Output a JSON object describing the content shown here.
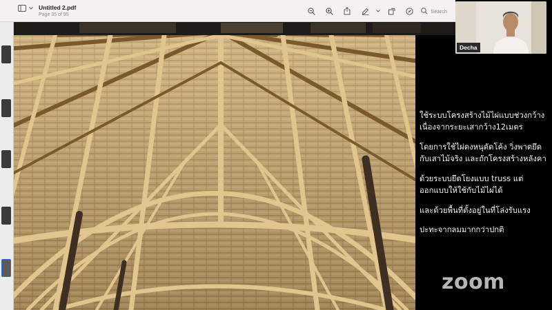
{
  "viewer": {
    "title": "Untitled 2.pdf",
    "subtitle": "Page 35 of 95",
    "search_placeholder": "Search",
    "icons": [
      "sidebar-toggle-icon",
      "chevron-down-icon",
      "zoom-out-icon",
      "zoom-in-icon",
      "share-icon",
      "markup-pen-icon",
      "chevron-down-icon",
      "rotate-icon",
      "annotate-icon",
      "search-icon"
    ]
  },
  "slide": {
    "photo_subject": "",
    "text": [
      "ใช้ระบบโครงสร้างไม้ไผ่แบบช่วงกว้าง เนื่องจากระยะเสากว้าง12เมตร",
      "โดยการใช้ไผ่ดงหนุดัดโค้ง วิ่งพาดยึดกับเสาไม้จริง และถักโครงสร้างหลังคา",
      "ด้วยระบบยึดโยงแบบ truss แต่ออกแบบให้ใช้กับไม้ไผ่ได้",
      "และด้วยพื้นที่ตั้งอยู่ในที่โล่งรับแรง",
      "ปะทะจากลมมากกว่าปกติ"
    ]
  },
  "participant": {
    "name": "Decha"
  },
  "zoom": {
    "logo": "zoom"
  },
  "colors": {
    "toolbar_bg": "#f3f2f1",
    "slide_bg": "#000000",
    "bamboo": "#c9ac79"
  }
}
